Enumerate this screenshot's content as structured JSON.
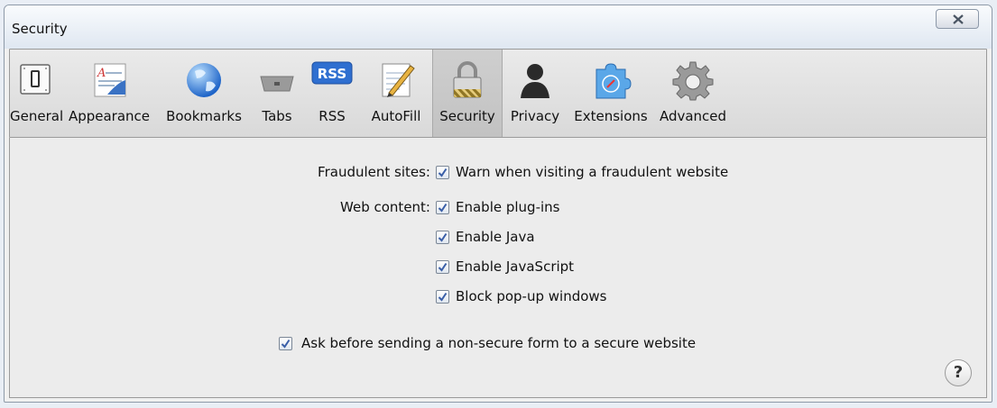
{
  "window": {
    "title": "Security"
  },
  "toolbar": {
    "items": [
      {
        "label": "General",
        "icon": "switch-icon"
      },
      {
        "label": "Appearance",
        "icon": "appearance-icon"
      },
      {
        "label": "Bookmarks",
        "icon": "globe-icon"
      },
      {
        "label": "Tabs",
        "icon": "tabs-icon"
      },
      {
        "label": "RSS",
        "icon": "rss-icon"
      },
      {
        "label": "AutoFill",
        "icon": "pencil-icon"
      },
      {
        "label": "Security",
        "icon": "lock-icon",
        "selected": true
      },
      {
        "label": "Privacy",
        "icon": "person-icon"
      },
      {
        "label": "Extensions",
        "icon": "puzzle-icon"
      },
      {
        "label": "Advanced",
        "icon": "gear-icon"
      }
    ],
    "rss_badge": "RSS"
  },
  "security": {
    "fraudulent_label": "Fraudulent sites:",
    "fraudulent_option": {
      "label": "Warn when visiting a fraudulent website",
      "checked": true
    },
    "web_content_label": "Web content:",
    "web_content_options": [
      {
        "label": "Enable plug-ins",
        "checked": true
      },
      {
        "label": "Enable Java",
        "checked": true
      },
      {
        "label": "Enable JavaScript",
        "checked": true
      },
      {
        "label": "Block pop-up windows",
        "checked": true
      }
    ],
    "nonsecure_form_option": {
      "label": "Ask before sending a non-secure form to a secure website",
      "checked": true
    }
  },
  "help": {
    "label": "?"
  },
  "colors": {
    "accent": "#3a72c4",
    "selected_tab": "#c8c8c8"
  }
}
